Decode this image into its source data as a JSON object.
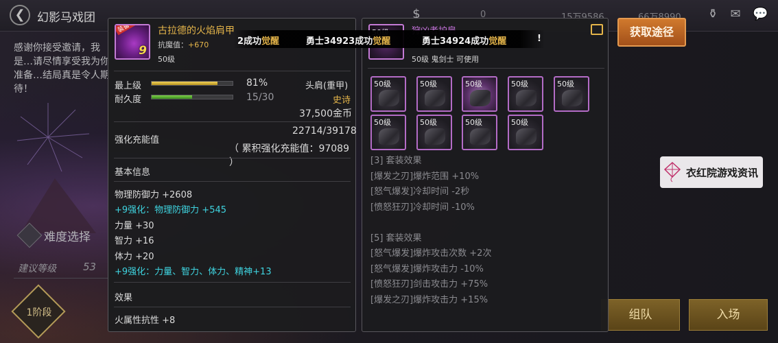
{
  "header": {
    "back_icon": "back-arrow-icon",
    "title": "幻影马戏团",
    "resources": [
      "0",
      "15万9586",
      "66万8990"
    ]
  },
  "left_scene": {
    "invite_text": "感谢你接受邀请，我是…请尽情享受我为你准备…结局真是令人期待！",
    "difficulty_label": "难度选择",
    "recommended_label": "建议等级",
    "recommended_value": "53",
    "stage_label": "1阶段"
  },
  "buttons": {
    "acquire": "获取途径",
    "team": "组队",
    "enter": "入场"
  },
  "broadcast": {
    "seg1_prefix": "2成功",
    "seg1_awaken": "觉醒",
    "seg2_prefix": "勇士34923成功",
    "seg2_awaken": "觉醒",
    "seg3_prefix": "勇士34924成功",
    "seg3_awaken": "觉醒",
    "seg4": "!"
  },
  "item_left": {
    "equip_tag": "装备中",
    "enhance": "9",
    "name": "古拉德的火焰肩甲",
    "resist_label": "抗魔值：",
    "resist_value": "+670",
    "level": "50级",
    "top_level_label": "最上级",
    "top_level_pct": "81%",
    "top_level_fraction": 0.81,
    "durability_label": "耐久度",
    "durability": "15/30",
    "durability_fraction": 0.5,
    "slot_type": "头肩(重甲)",
    "rarity": "史诗",
    "price": "37,500金币",
    "charge_value": "22714/39178",
    "charge_label": "强化充能值",
    "charge_accum": "（ 累积强化充能值：97089 ）",
    "basic_info_title": "基本信息",
    "stats": [
      {
        "text": "物理防御力 +2608",
        "color": "white"
      },
      {
        "text": "+9强化：物理防御力 +545",
        "color": "cyan"
      },
      {
        "text": "力量 +30",
        "color": "white"
      },
      {
        "text": "智力 +16",
        "color": "white"
      },
      {
        "text": "体力 +20",
        "color": "white"
      },
      {
        "text": "+9强化：力量、智力、体力、精神+13",
        "color": "cyan"
      }
    ],
    "effect_title": "效果",
    "effect_text": "火属性抗性 +8"
  },
  "item_right": {
    "level_tag": "50级",
    "name": "狩凶者护肩",
    "subline": "50级 鬼剑士 可使用",
    "share_icon": "share-icon",
    "slots": [
      "50级",
      "50级",
      "50级",
      "50级",
      "50级",
      "50级",
      "50级",
      "50级",
      "50级"
    ],
    "set3_title": "[3] 套装效果",
    "set3_lines": [
      "[爆发之刃]爆炸范围 +10%",
      "[怒气爆发]冷却时间 -2秒",
      "[愤怒狂刃]冷却时间 -10%"
    ],
    "set5_title": "[5] 套装效果",
    "set5_lines": [
      "[怒气爆发]爆炸攻击次数 +2次",
      "[怒气爆发]爆炸攻击力 -10%",
      "[愤怒狂刃]剑击攻击力 +75%",
      "[爆发之刃]爆炸攻击力 +15%"
    ]
  },
  "watermark": {
    "text": "衣红院游戏资讯",
    "icon": "kite-icon"
  },
  "colors": {
    "epic": "#e5b54a",
    "cyan": "#3fd4e0",
    "set_purple": "#c070d6"
  }
}
